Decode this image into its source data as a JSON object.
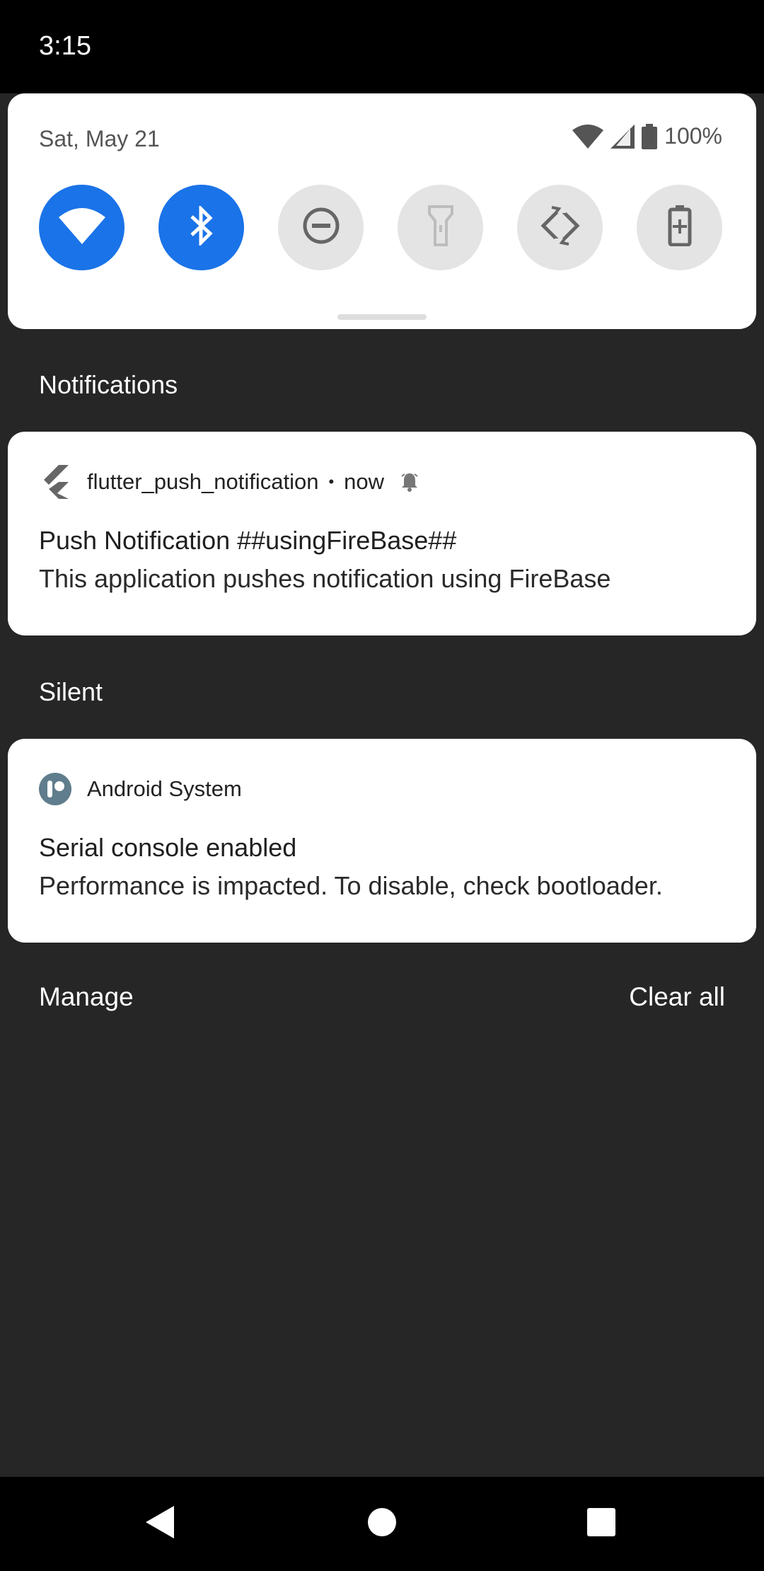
{
  "status_bar": {
    "time": "3:15"
  },
  "quick_settings": {
    "date": "Sat, May 21",
    "battery": "100%",
    "tiles": [
      {
        "name": "wifi",
        "state": "on"
      },
      {
        "name": "bluetooth",
        "state": "on"
      },
      {
        "name": "do-not-disturb",
        "state": "off"
      },
      {
        "name": "flashlight",
        "state": "off"
      },
      {
        "name": "auto-rotate",
        "state": "off"
      },
      {
        "name": "battery-saver",
        "state": "off"
      }
    ]
  },
  "sections": {
    "notifications": "Notifications",
    "silent": "Silent"
  },
  "notification_1": {
    "app": "flutter_push_notification",
    "separator": "•",
    "time": "now",
    "title": "Push Notification ##usingFireBase##",
    "text": "This application pushes notification using FireBase"
  },
  "notification_2": {
    "app": "Android System",
    "title": "Serial console enabled",
    "text": "Performance is impacted. To disable, check bootloader."
  },
  "footer": {
    "manage": "Manage",
    "clear_all": "Clear all"
  },
  "colors": {
    "accent": "#1a73e8",
    "background": "#262626"
  }
}
